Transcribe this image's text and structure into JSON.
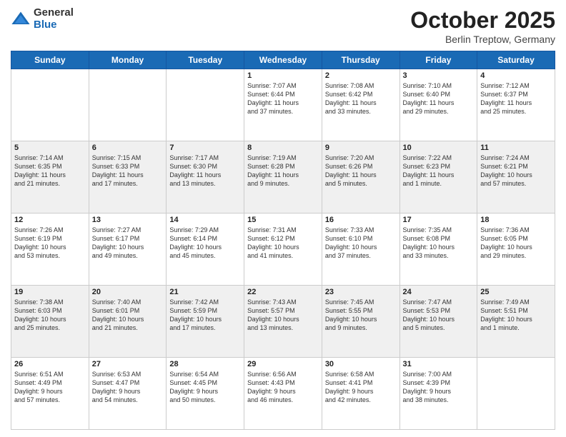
{
  "logo": {
    "general": "General",
    "blue": "Blue"
  },
  "header": {
    "month": "October 2025",
    "location": "Berlin Treptow, Germany"
  },
  "days_of_week": [
    "Sunday",
    "Monday",
    "Tuesday",
    "Wednesday",
    "Thursday",
    "Friday",
    "Saturday"
  ],
  "weeks": [
    [
      {
        "day": "",
        "info": ""
      },
      {
        "day": "",
        "info": ""
      },
      {
        "day": "",
        "info": ""
      },
      {
        "day": "1",
        "info": "Sunrise: 7:07 AM\nSunset: 6:44 PM\nDaylight: 11 hours\nand 37 minutes."
      },
      {
        "day": "2",
        "info": "Sunrise: 7:08 AM\nSunset: 6:42 PM\nDaylight: 11 hours\nand 33 minutes."
      },
      {
        "day": "3",
        "info": "Sunrise: 7:10 AM\nSunset: 6:40 PM\nDaylight: 11 hours\nand 29 minutes."
      },
      {
        "day": "4",
        "info": "Sunrise: 7:12 AM\nSunset: 6:37 PM\nDaylight: 11 hours\nand 25 minutes."
      }
    ],
    [
      {
        "day": "5",
        "info": "Sunrise: 7:14 AM\nSunset: 6:35 PM\nDaylight: 11 hours\nand 21 minutes."
      },
      {
        "day": "6",
        "info": "Sunrise: 7:15 AM\nSunset: 6:33 PM\nDaylight: 11 hours\nand 17 minutes."
      },
      {
        "day": "7",
        "info": "Sunrise: 7:17 AM\nSunset: 6:30 PM\nDaylight: 11 hours\nand 13 minutes."
      },
      {
        "day": "8",
        "info": "Sunrise: 7:19 AM\nSunset: 6:28 PM\nDaylight: 11 hours\nand 9 minutes."
      },
      {
        "day": "9",
        "info": "Sunrise: 7:20 AM\nSunset: 6:26 PM\nDaylight: 11 hours\nand 5 minutes."
      },
      {
        "day": "10",
        "info": "Sunrise: 7:22 AM\nSunset: 6:23 PM\nDaylight: 11 hours\nand 1 minute."
      },
      {
        "day": "11",
        "info": "Sunrise: 7:24 AM\nSunset: 6:21 PM\nDaylight: 10 hours\nand 57 minutes."
      }
    ],
    [
      {
        "day": "12",
        "info": "Sunrise: 7:26 AM\nSunset: 6:19 PM\nDaylight: 10 hours\nand 53 minutes."
      },
      {
        "day": "13",
        "info": "Sunrise: 7:27 AM\nSunset: 6:17 PM\nDaylight: 10 hours\nand 49 minutes."
      },
      {
        "day": "14",
        "info": "Sunrise: 7:29 AM\nSunset: 6:14 PM\nDaylight: 10 hours\nand 45 minutes."
      },
      {
        "day": "15",
        "info": "Sunrise: 7:31 AM\nSunset: 6:12 PM\nDaylight: 10 hours\nand 41 minutes."
      },
      {
        "day": "16",
        "info": "Sunrise: 7:33 AM\nSunset: 6:10 PM\nDaylight: 10 hours\nand 37 minutes."
      },
      {
        "day": "17",
        "info": "Sunrise: 7:35 AM\nSunset: 6:08 PM\nDaylight: 10 hours\nand 33 minutes."
      },
      {
        "day": "18",
        "info": "Sunrise: 7:36 AM\nSunset: 6:05 PM\nDaylight: 10 hours\nand 29 minutes."
      }
    ],
    [
      {
        "day": "19",
        "info": "Sunrise: 7:38 AM\nSunset: 6:03 PM\nDaylight: 10 hours\nand 25 minutes."
      },
      {
        "day": "20",
        "info": "Sunrise: 7:40 AM\nSunset: 6:01 PM\nDaylight: 10 hours\nand 21 minutes."
      },
      {
        "day": "21",
        "info": "Sunrise: 7:42 AM\nSunset: 5:59 PM\nDaylight: 10 hours\nand 17 minutes."
      },
      {
        "day": "22",
        "info": "Sunrise: 7:43 AM\nSunset: 5:57 PM\nDaylight: 10 hours\nand 13 minutes."
      },
      {
        "day": "23",
        "info": "Sunrise: 7:45 AM\nSunset: 5:55 PM\nDaylight: 10 hours\nand 9 minutes."
      },
      {
        "day": "24",
        "info": "Sunrise: 7:47 AM\nSunset: 5:53 PM\nDaylight: 10 hours\nand 5 minutes."
      },
      {
        "day": "25",
        "info": "Sunrise: 7:49 AM\nSunset: 5:51 PM\nDaylight: 10 hours\nand 1 minute."
      }
    ],
    [
      {
        "day": "26",
        "info": "Sunrise: 6:51 AM\nSunset: 4:49 PM\nDaylight: 9 hours\nand 57 minutes."
      },
      {
        "day": "27",
        "info": "Sunrise: 6:53 AM\nSunset: 4:47 PM\nDaylight: 9 hours\nand 54 minutes."
      },
      {
        "day": "28",
        "info": "Sunrise: 6:54 AM\nSunset: 4:45 PM\nDaylight: 9 hours\nand 50 minutes."
      },
      {
        "day": "29",
        "info": "Sunrise: 6:56 AM\nSunset: 4:43 PM\nDaylight: 9 hours\nand 46 minutes."
      },
      {
        "day": "30",
        "info": "Sunrise: 6:58 AM\nSunset: 4:41 PM\nDaylight: 9 hours\nand 42 minutes."
      },
      {
        "day": "31",
        "info": "Sunrise: 7:00 AM\nSunset: 4:39 PM\nDaylight: 9 hours\nand 38 minutes."
      },
      {
        "day": "",
        "info": ""
      }
    ]
  ]
}
